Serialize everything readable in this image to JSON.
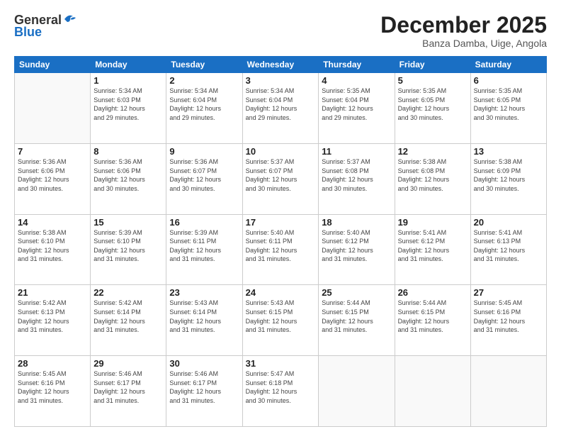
{
  "header": {
    "logo_general": "General",
    "logo_blue": "Blue",
    "month_title": "December 2025",
    "location": "Banza Damba, Uige, Angola"
  },
  "days_of_week": [
    "Sunday",
    "Monday",
    "Tuesday",
    "Wednesday",
    "Thursday",
    "Friday",
    "Saturday"
  ],
  "weeks": [
    [
      {
        "day": "",
        "info": ""
      },
      {
        "day": "1",
        "info": "Sunrise: 5:34 AM\nSunset: 6:03 PM\nDaylight: 12 hours\nand 29 minutes."
      },
      {
        "day": "2",
        "info": "Sunrise: 5:34 AM\nSunset: 6:04 PM\nDaylight: 12 hours\nand 29 minutes."
      },
      {
        "day": "3",
        "info": "Sunrise: 5:34 AM\nSunset: 6:04 PM\nDaylight: 12 hours\nand 29 minutes."
      },
      {
        "day": "4",
        "info": "Sunrise: 5:35 AM\nSunset: 6:04 PM\nDaylight: 12 hours\nand 29 minutes."
      },
      {
        "day": "5",
        "info": "Sunrise: 5:35 AM\nSunset: 6:05 PM\nDaylight: 12 hours\nand 30 minutes."
      },
      {
        "day": "6",
        "info": "Sunrise: 5:35 AM\nSunset: 6:05 PM\nDaylight: 12 hours\nand 30 minutes."
      }
    ],
    [
      {
        "day": "7",
        "info": "Sunrise: 5:36 AM\nSunset: 6:06 PM\nDaylight: 12 hours\nand 30 minutes."
      },
      {
        "day": "8",
        "info": "Sunrise: 5:36 AM\nSunset: 6:06 PM\nDaylight: 12 hours\nand 30 minutes."
      },
      {
        "day": "9",
        "info": "Sunrise: 5:36 AM\nSunset: 6:07 PM\nDaylight: 12 hours\nand 30 minutes."
      },
      {
        "day": "10",
        "info": "Sunrise: 5:37 AM\nSunset: 6:07 PM\nDaylight: 12 hours\nand 30 minutes."
      },
      {
        "day": "11",
        "info": "Sunrise: 5:37 AM\nSunset: 6:08 PM\nDaylight: 12 hours\nand 30 minutes."
      },
      {
        "day": "12",
        "info": "Sunrise: 5:38 AM\nSunset: 6:08 PM\nDaylight: 12 hours\nand 30 minutes."
      },
      {
        "day": "13",
        "info": "Sunrise: 5:38 AM\nSunset: 6:09 PM\nDaylight: 12 hours\nand 30 minutes."
      }
    ],
    [
      {
        "day": "14",
        "info": "Sunrise: 5:38 AM\nSunset: 6:10 PM\nDaylight: 12 hours\nand 31 minutes."
      },
      {
        "day": "15",
        "info": "Sunrise: 5:39 AM\nSunset: 6:10 PM\nDaylight: 12 hours\nand 31 minutes."
      },
      {
        "day": "16",
        "info": "Sunrise: 5:39 AM\nSunset: 6:11 PM\nDaylight: 12 hours\nand 31 minutes."
      },
      {
        "day": "17",
        "info": "Sunrise: 5:40 AM\nSunset: 6:11 PM\nDaylight: 12 hours\nand 31 minutes."
      },
      {
        "day": "18",
        "info": "Sunrise: 5:40 AM\nSunset: 6:12 PM\nDaylight: 12 hours\nand 31 minutes."
      },
      {
        "day": "19",
        "info": "Sunrise: 5:41 AM\nSunset: 6:12 PM\nDaylight: 12 hours\nand 31 minutes."
      },
      {
        "day": "20",
        "info": "Sunrise: 5:41 AM\nSunset: 6:13 PM\nDaylight: 12 hours\nand 31 minutes."
      }
    ],
    [
      {
        "day": "21",
        "info": "Sunrise: 5:42 AM\nSunset: 6:13 PM\nDaylight: 12 hours\nand 31 minutes."
      },
      {
        "day": "22",
        "info": "Sunrise: 5:42 AM\nSunset: 6:14 PM\nDaylight: 12 hours\nand 31 minutes."
      },
      {
        "day": "23",
        "info": "Sunrise: 5:43 AM\nSunset: 6:14 PM\nDaylight: 12 hours\nand 31 minutes."
      },
      {
        "day": "24",
        "info": "Sunrise: 5:43 AM\nSunset: 6:15 PM\nDaylight: 12 hours\nand 31 minutes."
      },
      {
        "day": "25",
        "info": "Sunrise: 5:44 AM\nSunset: 6:15 PM\nDaylight: 12 hours\nand 31 minutes."
      },
      {
        "day": "26",
        "info": "Sunrise: 5:44 AM\nSunset: 6:15 PM\nDaylight: 12 hours\nand 31 minutes."
      },
      {
        "day": "27",
        "info": "Sunrise: 5:45 AM\nSunset: 6:16 PM\nDaylight: 12 hours\nand 31 minutes."
      }
    ],
    [
      {
        "day": "28",
        "info": "Sunrise: 5:45 AM\nSunset: 6:16 PM\nDaylight: 12 hours\nand 31 minutes."
      },
      {
        "day": "29",
        "info": "Sunrise: 5:46 AM\nSunset: 6:17 PM\nDaylight: 12 hours\nand 31 minutes."
      },
      {
        "day": "30",
        "info": "Sunrise: 5:46 AM\nSunset: 6:17 PM\nDaylight: 12 hours\nand 31 minutes."
      },
      {
        "day": "31",
        "info": "Sunrise: 5:47 AM\nSunset: 6:18 PM\nDaylight: 12 hours\nand 30 minutes."
      },
      {
        "day": "",
        "info": ""
      },
      {
        "day": "",
        "info": ""
      },
      {
        "day": "",
        "info": ""
      }
    ]
  ]
}
